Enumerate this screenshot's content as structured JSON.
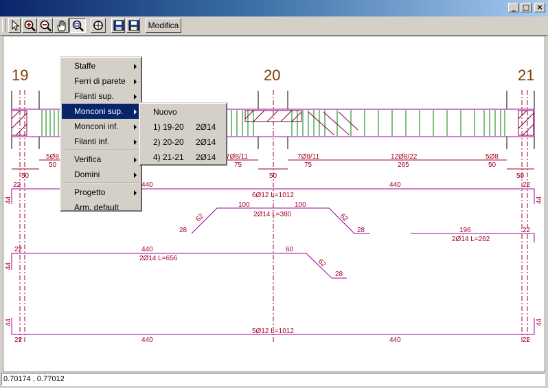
{
  "toolbar": {
    "modifica_label": "Modifica"
  },
  "drawing": {
    "axes": [
      "19",
      "20",
      "21"
    ],
    "texts": {
      "s1": "5Ø8",
      "s2": "7Ø8/11",
      "s3": "7Ø8/11",
      "s4": "12Ø8/22",
      "s5": "5Ø8",
      "d50a": "50",
      "d75a": "75",
      "d75b": "75",
      "d265": "265",
      "d50b": "50",
      "b50a": "50",
      "b50b": "50",
      "b50c": "50",
      "t22a": "22",
      "t440a": "440",
      "bar1": "6Ø12 L=1012",
      "t440b": "440",
      "t22b": "22",
      "t44a": "44",
      "t44b": "44",
      "t100a": "100",
      "t100b": "100",
      "bar2": "2Ø14 L=380",
      "t62a": "62",
      "t62b": "62",
      "t28a": "28",
      "t28b": "28",
      "t196": "196",
      "t22c": "22",
      "bar3": "2Ø14 L=262",
      "t22d": "22",
      "t440c": "440",
      "t60": "60",
      "bar4": "2Ø14 L=656",
      "t62c": "62",
      "t28c": "28",
      "t44c": "44",
      "t44d": "44",
      "t44e": "44",
      "bar5": "5Ø12 L=1012",
      "t22e": "22",
      "t440d": "440",
      "t440e": "440",
      "t22f": "22"
    }
  },
  "context_menu": {
    "items": [
      "Staffe",
      "Ferri di parete",
      "Filanti sup.",
      "Monconi sup.",
      "Monconi inf.",
      "Filanti inf.",
      "Verifica",
      "Domini",
      "Progetto",
      "Arm. default"
    ]
  },
  "submenu": {
    "new_label": "Nuovo",
    "items": [
      {
        "label": "1) 19-20",
        "bars": "2Ø14"
      },
      {
        "label": "2) 20-20",
        "bars": "2Ø14"
      },
      {
        "label": "4) 21-21",
        "bars": "2Ø14"
      }
    ]
  },
  "status": {
    "coords": "0.70174 , 0.77012"
  }
}
